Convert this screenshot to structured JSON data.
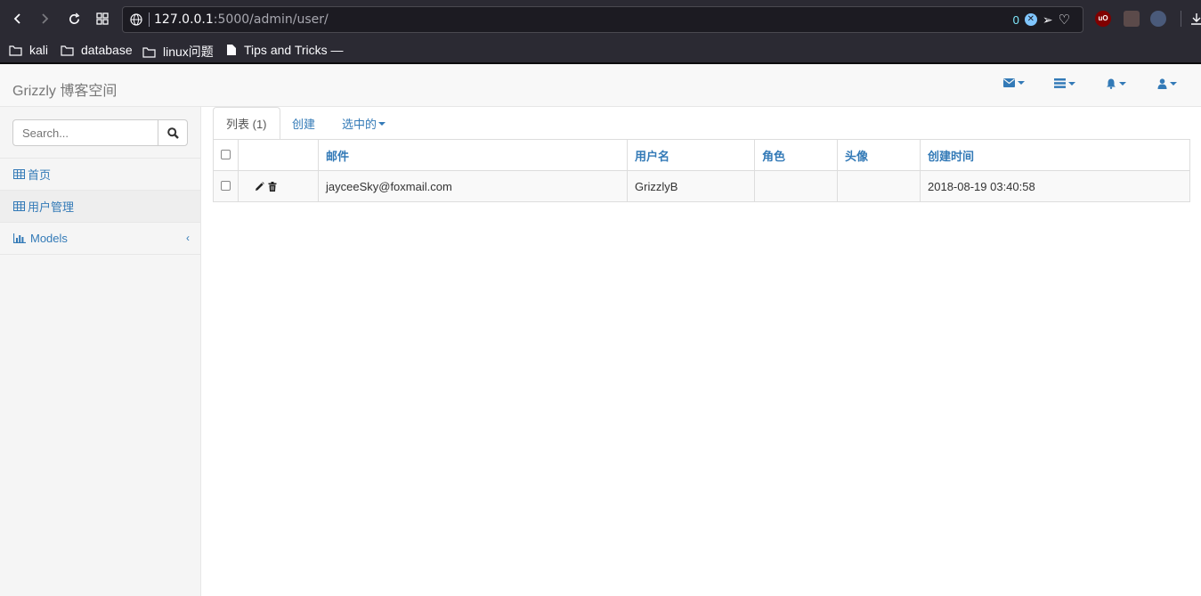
{
  "browser": {
    "url_host": "127.0.0.1",
    "url_path": ":5000/admin/user/",
    "tracker_count": "0",
    "bookmarks": [
      {
        "label": "kali",
        "icon": "folder-icon"
      },
      {
        "label": "database",
        "icon": "folder-icon"
      },
      {
        "label": "linux问题",
        "icon": "folder-icon"
      },
      {
        "label": "Tips and Tricks —",
        "icon": "file-icon"
      }
    ]
  },
  "navbar": {
    "brand": "Grizzly 博客空间",
    "menus": [
      {
        "name": "mail-menu",
        "icon": "envelope-icon"
      },
      {
        "name": "list-menu",
        "icon": "list-icon"
      },
      {
        "name": "notification-menu",
        "icon": "bell-icon"
      },
      {
        "name": "user-menu",
        "icon": "user-icon"
      }
    ]
  },
  "sidebar": {
    "search_placeholder": "Search...",
    "items": [
      {
        "label": "首页",
        "icon": "table-icon",
        "active": false
      },
      {
        "label": "用户管理",
        "icon": "table-icon",
        "active": true
      },
      {
        "label": "Models",
        "icon": "bar-chart-icon",
        "active": false
      }
    ]
  },
  "tabs": {
    "list": "列表 (1)",
    "create": "创建",
    "selected": "选中的"
  },
  "table": {
    "headers": [
      "邮件",
      "用户名",
      "角色",
      "头像",
      "创建时间"
    ],
    "rows": [
      {
        "email": "jayceeSky@foxmail.com",
        "username": "GrizzlyB",
        "role": "",
        "avatar": "",
        "created": "2018-08-19 03:40:58"
      }
    ]
  },
  "colors": {
    "link": "#337ab7",
    "chrome_bg": "#2b2a33",
    "navbar_bg": "#f8f8f8",
    "sidebar_bg": "#f5f5f5"
  }
}
